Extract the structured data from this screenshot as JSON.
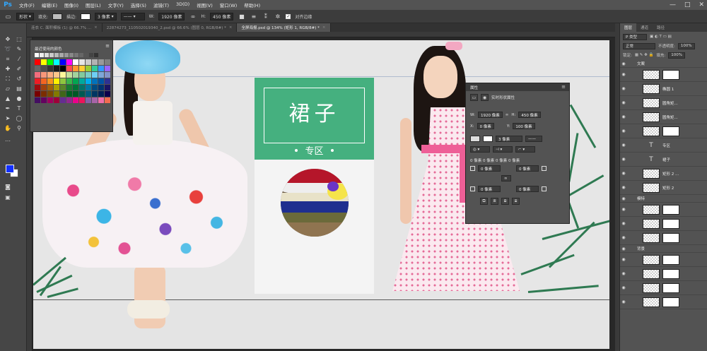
{
  "app": {
    "logo": "Ps"
  },
  "menu": [
    "文件(F)",
    "编辑(E)",
    "图像(I)",
    "图层(L)",
    "文字(Y)",
    "选择(S)",
    "滤镜(T)",
    "3D(D)",
    "视图(V)",
    "窗口(W)",
    "帮助(H)"
  ],
  "window_controls": {
    "minimize": "—",
    "maximize": "□",
    "close": "✕"
  },
  "options": {
    "mode": "形状",
    "fill_label": "填充:",
    "stroke_label": "描边:",
    "stroke_width": "3 像素",
    "w_label": "W:",
    "w_value": "1920 像素",
    "h_label": "H:",
    "h_value": "450 像素",
    "align_edges_label": "对齐边缘"
  },
  "doc_tabs": [
    {
      "label": "连衣 C. 面积模板 (1) @ 66.7% ...",
      "active": false
    },
    {
      "label": "22874273_110502019340_2.psd @ 66.6% (图层 0, RGB/8#) *",
      "active": false
    },
    {
      "label": "全屏海报.psd @ 134% (矩形 1, RGB/8#) *",
      "active": true
    }
  ],
  "document": {
    "title": "裙子",
    "subtitle": "专区"
  },
  "swatch_panel": {
    "title": "最近使用的颜色",
    "recent": [
      "#ffffff",
      "#eeeeee",
      "#dddddd",
      "#cccccc",
      "#bbbbbb",
      "#aaaaaa",
      "#999999",
      "#888888",
      "#777777",
      "#666666",
      "#555555",
      "#444444",
      "#333333"
    ],
    "grid": [
      "#ff0000",
      "#ffff00",
      "#00ff00",
      "#00ffff",
      "#0000ff",
      "#ff00ff",
      "#ffffff",
      "#e6e6e6",
      "#cccccc",
      "#b3b3b3",
      "#999999",
      "#808080",
      "#666666",
      "#4d4d4d",
      "#333333",
      "#1a1a1a",
      "#000000",
      "#ff4d4d",
      "#ff9933",
      "#ffcc33",
      "#99cc33",
      "#33cc99",
      "#3399ff",
      "#9966ff",
      "#f26d7d",
      "#f7977a",
      "#fbad82",
      "#fdc68a",
      "#fff79a",
      "#c4df9b",
      "#a3d39c",
      "#82ca9d",
      "#7bcdc8",
      "#6ecff6",
      "#7ea7d8",
      "#8493ca",
      "#ed1c24",
      "#f26522",
      "#f7941d",
      "#fff200",
      "#8dc63f",
      "#39b54a",
      "#00a651",
      "#00a99d",
      "#00aeef",
      "#0072bc",
      "#0054a6",
      "#2e3192",
      "#9e0b0f",
      "#a0410d",
      "#a36209",
      "#aba000",
      "#598527",
      "#197b30",
      "#007236",
      "#00746b",
      "#0076a3",
      "#004a80",
      "#003471",
      "#1b1464",
      "#790000",
      "#7b2e00",
      "#7d4900",
      "#827b00",
      "#406618",
      "#005e20",
      "#005826",
      "#005952",
      "#005b7f",
      "#003663",
      "#002157",
      "#0d004c",
      "#440e62",
      "#630460",
      "#9e005d",
      "#9e0039",
      "#662d91",
      "#92278f",
      "#ec008c",
      "#ed145b",
      "#8560a8",
      "#a864a8",
      "#f06eaa",
      "#f26c4f"
    ],
    "menu_icon": "≡"
  },
  "properties": {
    "title": "属性",
    "subtitle": "实时形状属性",
    "w_label": "W:",
    "w_value": "1920 像素",
    "h_label": "H:",
    "h_value": "450 像素",
    "x_label": "X:",
    "x_value": "0 像素",
    "y_label": "Y:",
    "y_value": "100 像素",
    "stroke_size": "3 像素",
    "corner_all": "0 像素 0 像素 0 像素 0 像素",
    "corner_tl": "0 像素",
    "corner_tr": "0 像素",
    "corner_bl": "0 像素",
    "corner_br": "0 像素",
    "close": "≡"
  },
  "layers_panel": {
    "tabs": [
      "图层",
      "通道",
      "路径"
    ],
    "filter": "P 类型",
    "blend_mode": "正常",
    "opacity_label": "不透明度:",
    "opacity_value": "100%",
    "lock_label": "锁定:",
    "fill_label": "填充:",
    "fill_value": "100%",
    "rows": [
      {
        "kind": "group",
        "name": "文案"
      },
      {
        "kind": "layer",
        "name": ""
      },
      {
        "kind": "layer",
        "name": "椭圆 1"
      },
      {
        "kind": "layer",
        "name": "圆角矩..."
      },
      {
        "kind": "layer",
        "name": "圆角矩..."
      },
      {
        "kind": "layer",
        "name": ""
      },
      {
        "kind": "text",
        "name": "专区"
      },
      {
        "kind": "text",
        "name": "裙子"
      },
      {
        "kind": "layer",
        "name": "矩形 2 ..."
      },
      {
        "kind": "layer",
        "name": "矩形 2"
      },
      {
        "kind": "group",
        "name": "模特"
      },
      {
        "kind": "layer",
        "name": ""
      },
      {
        "kind": "layer",
        "name": ""
      },
      {
        "kind": "layer",
        "name": ""
      },
      {
        "kind": "group",
        "name": "背景"
      },
      {
        "kind": "layer",
        "name": ""
      },
      {
        "kind": "layer",
        "name": ""
      },
      {
        "kind": "layer",
        "name": ""
      },
      {
        "kind": "layer",
        "name": ""
      }
    ]
  }
}
